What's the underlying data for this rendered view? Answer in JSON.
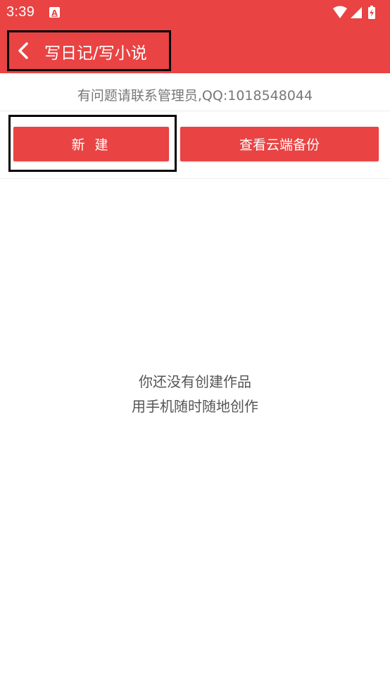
{
  "status_bar": {
    "time": "3:39",
    "icons": [
      "app-notification-icon",
      "wifi-icon",
      "signal-icon",
      "battery-charging-icon"
    ]
  },
  "app_bar": {
    "back_icon": "chevron-left-icon",
    "title": "写日记/写小说",
    "background_color": "#e94343"
  },
  "notice": {
    "text": "有问题请联系管理员,QQ:1018548044"
  },
  "actions": {
    "new_label": "新 建",
    "cloud_backup_label": "查看云端备份",
    "button_color": "#e94343"
  },
  "empty_state": {
    "line1": "你还没有创建作品",
    "line2": "用手机随时随地创作"
  }
}
